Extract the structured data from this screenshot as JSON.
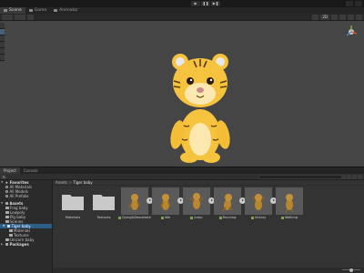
{
  "toolbar": {
    "play_icon": "play-icon",
    "pause_icon": "pause-icon",
    "step_icon": "step-icon"
  },
  "scene_tabs": [
    {
      "label": "Scene",
      "active": true
    },
    {
      "label": "Game",
      "active": false
    },
    {
      "label": "Animator",
      "active": false
    }
  ],
  "scene_toolbar": {
    "view_mode": "■",
    "dim_toggle": "2D"
  },
  "bottom_tabs": [
    {
      "label": "Project",
      "active": true
    },
    {
      "label": "Console",
      "active": false
    }
  ],
  "project": {
    "add_label": "+",
    "tree": [
      {
        "label": "Favorites",
        "level": 0,
        "head": true,
        "icon": "star"
      },
      {
        "label": "All Materials",
        "level": 1,
        "icon": "search"
      },
      {
        "label": "All Models",
        "level": 1,
        "icon": "search"
      },
      {
        "label": "All Prefabs",
        "level": 1,
        "icon": "search"
      },
      {
        "label": "Assets",
        "level": 0,
        "head": true,
        "icon": "folder"
      },
      {
        "label": "Frog baby",
        "level": 1,
        "icon": "folder"
      },
      {
        "label": "Lowpoly",
        "level": 1,
        "icon": "folder"
      },
      {
        "label": "Pig baby",
        "level": 1,
        "icon": "folder"
      },
      {
        "label": "Scenes",
        "level": 1,
        "icon": "folder"
      },
      {
        "label": "Tiger baby",
        "level": 1,
        "icon": "folder",
        "selected": true
      },
      {
        "label": "Materials",
        "level": 2,
        "icon": "folder"
      },
      {
        "label": "Textures",
        "level": 2,
        "icon": "folder"
      },
      {
        "label": "Unicorn baby",
        "level": 1,
        "icon": "folder"
      },
      {
        "label": "Packages",
        "level": 0,
        "head": true,
        "icon": "folder"
      }
    ],
    "breadcrumb": [
      "Assets",
      "Tiger baby"
    ],
    "assets": [
      {
        "label": "Materials",
        "kind": "folder"
      },
      {
        "label": "Textures",
        "kind": "folder"
      },
      {
        "label": "Dying&Deadstate",
        "kind": "anim"
      },
      {
        "label": "Idle",
        "kind": "anim"
      },
      {
        "label": "Jump",
        "kind": "anim"
      },
      {
        "label": "Running",
        "kind": "anim"
      },
      {
        "label": "Victory",
        "kind": "anim"
      },
      {
        "label": "Walking",
        "kind": "anim"
      }
    ]
  },
  "colors": {
    "viewport_bg": "#454545",
    "tiger_body": "#f6c33f",
    "tiger_stripe": "#5a3a10",
    "selection": "#2c5d87"
  }
}
